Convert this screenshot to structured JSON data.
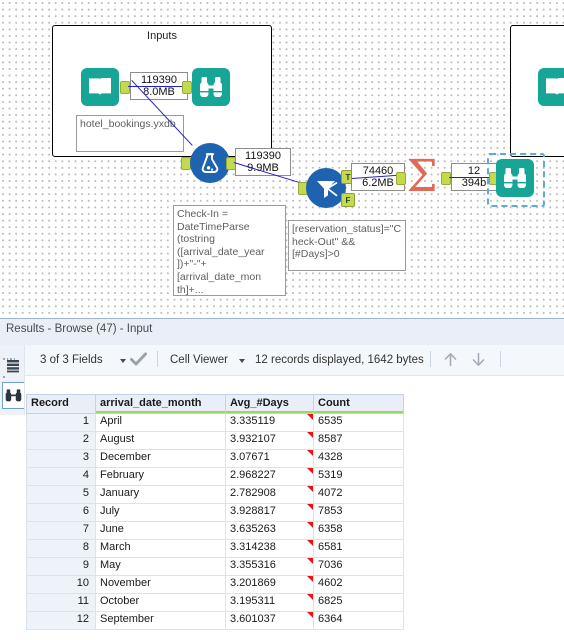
{
  "canvas": {
    "containers": [
      {
        "title": "Inputs"
      },
      {
        "title": ""
      }
    ],
    "tools": [
      {
        "name": "input-data-tool",
        "icon": "book-icon",
        "label": "hotel_bookings.yxdb"
      },
      {
        "name": "browse-tool-1",
        "icon": "binoculars-icon",
        "label": ""
      },
      {
        "name": "formula-tool",
        "icon": "flask-icon",
        "label": "Check-In = DateTimeParse(tostring([arrival_date_year])+\"-\"+[arrival_date_month]+..."
      },
      {
        "name": "filter-tool",
        "icon": "funnel-icon",
        "label": "[reservation_status]=\"Check-Out\" && [#Days]>0"
      },
      {
        "name": "summarize-tool",
        "icon": "sigma-icon",
        "label": ""
      },
      {
        "name": "browse-tool-2",
        "icon": "binoculars-icon",
        "label": ""
      },
      {
        "name": "input-data-tool-2",
        "icon": "book-icon",
        "label": ""
      }
    ],
    "annotations": {
      "input_file": "hotel_bookings.yxdb",
      "formula_expr": "Check-In = DateTimeParse (tostring ([arrival_date_year ])+\"-\"+ [arrival_date_mon th]+...",
      "filter_expr": "[reservation_status]=\"Check-Out\" && [#Days]>0"
    },
    "record_labels": [
      {
        "records": "119390",
        "size": "8.0MB"
      },
      {
        "records": "119390",
        "size": "9.9MB"
      },
      {
        "records": "74460",
        "size": "6.2MB"
      },
      {
        "records": "12",
        "size": "394b"
      }
    ],
    "filter_anchors": {
      "true": "T",
      "false": "F"
    }
  },
  "results": {
    "title": "Results - Browse (47) - Input",
    "toolbar": {
      "fields_label": "3 of 3 Fields",
      "check_icon": "checkmark-icon",
      "viewer_label": "Cell Viewer",
      "status_label": "12 records displayed, 1642 bytes",
      "up_icon": "arrow-up-icon",
      "down_icon": "arrow-down-icon"
    },
    "rail": {
      "list_icon": "list-view-icon",
      "browse_icon": "binoculars-icon"
    },
    "table": {
      "columns": [
        "Record",
        "arrival_date_month",
        "Avg_#Days",
        "Count"
      ],
      "rows": [
        [
          "1",
          "April",
          "3.335119",
          "6535"
        ],
        [
          "2",
          "August",
          "3.932107",
          "8587"
        ],
        [
          "3",
          "December",
          "3.07671",
          "4328"
        ],
        [
          "4",
          "February",
          "2.968227",
          "5319"
        ],
        [
          "5",
          "January",
          "2.782908",
          "4072"
        ],
        [
          "6",
          "July",
          "3.928817",
          "7853"
        ],
        [
          "7",
          "June",
          "3.635263",
          "6358"
        ],
        [
          "8",
          "March",
          "3.314238",
          "6581"
        ],
        [
          "9",
          "May",
          "3.355316",
          "7036"
        ],
        [
          "10",
          "November",
          "3.201869",
          "4602"
        ],
        [
          "11",
          "October",
          "3.195311",
          "6825"
        ],
        [
          "12",
          "September",
          "3.601037",
          "6364"
        ]
      ]
    }
  },
  "colors": {
    "tool_teal": "#16a596",
    "tool_blue": "#1e63b0",
    "tool_orange": "#e06a55",
    "anchor_green": "#c3d94e",
    "header_green": "#96d860",
    "wire_blue": "#2222cc",
    "selection_blue": "#5fa8dd"
  }
}
